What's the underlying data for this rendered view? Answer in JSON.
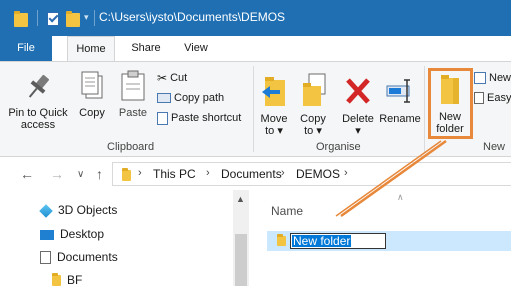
{
  "titlebar": {
    "path": "C:\\Users\\iysto\\Documents\\DEMOS"
  },
  "tabs": {
    "file": "File",
    "home": "Home",
    "share": "Share",
    "view": "View"
  },
  "ribbon": {
    "clipboard": {
      "pin": [
        "Pin to Quick",
        "access"
      ],
      "copy": "Copy",
      "paste": "Paste",
      "cut": "Cut",
      "copy_path": "Copy path",
      "paste_shortcut": "Paste shortcut",
      "group": "Clipboard"
    },
    "organise": {
      "move_to": "Move",
      "move_to_2": "to",
      "copy_to": "Copy",
      "copy_to_2": "to",
      "delete": "Delete",
      "rename": "Rename",
      "group": "Organise"
    },
    "new": {
      "new_folder": "New",
      "new_folder_2": "folder",
      "new_item": "New",
      "easy_access": "Easy",
      "group": "New"
    }
  },
  "address": {
    "crumbs": [
      "This PC",
      "Documents",
      "DEMOS"
    ]
  },
  "navpane": {
    "items": [
      {
        "label": "3D Objects",
        "icon": "3d-objects-icon"
      },
      {
        "label": "Desktop",
        "icon": "desktop-icon"
      },
      {
        "label": "Documents",
        "icon": "documents-icon"
      },
      {
        "label": "BF",
        "icon": "folder-icon"
      }
    ]
  },
  "content": {
    "column_name": "Name",
    "rename_value": "New folder"
  },
  "colors": {
    "title_blue": "#1f6fb2",
    "selection": "#cce8ff",
    "highlight": "#e8883a",
    "folder": "#f3c342"
  }
}
